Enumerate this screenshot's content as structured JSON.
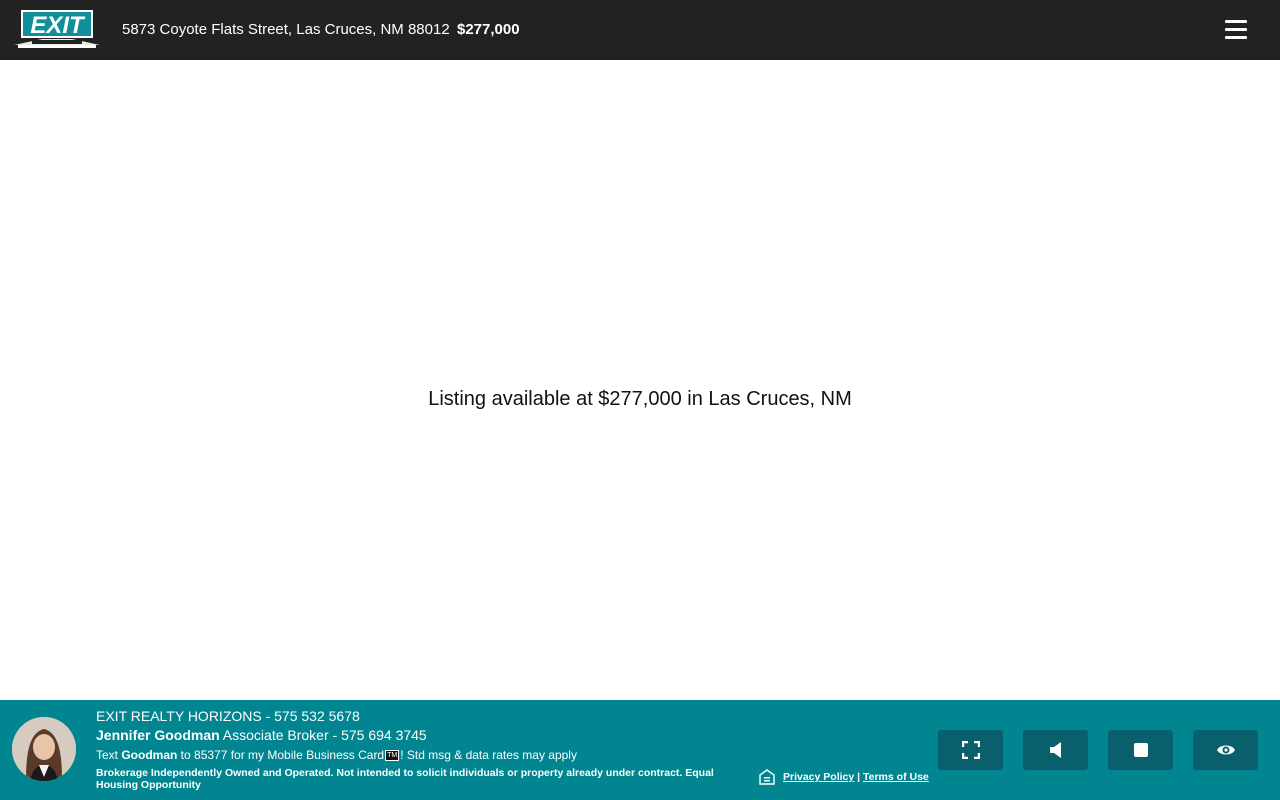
{
  "header": {
    "logo_text": "EXIT",
    "address": "5873 Coyote Flats Street, Las Cruces, NM 88012",
    "price": "$277,000",
    "menu_icon": "hamburger-menu-icon"
  },
  "main": {
    "message": "Listing available at $277,000 in Las Cruces, NM"
  },
  "footer": {
    "brokerage": "EXIT REALTY HORIZONS - 575 532 5678",
    "agent_name": "Jennifer Goodman",
    "agent_title": " Associate Broker - 575 694 3745",
    "sms_prefix": "Text ",
    "sms_keyword": "Goodman",
    "sms_middle": " to 85377 for my Mobile Business Card",
    "sms_tm": "TM",
    "sms_suffix": "! Std msg & data rates may apply",
    "disclaimer": "Brokerage Independently Owned and Operated. Not intended to solicit individuals or property already under contract. Equal Housing Opportunity",
    "privacy_label": "Privacy Policy",
    "link_separator": " | ",
    "terms_label": "Terms of Use",
    "controls": [
      {
        "name": "fullscreen-button",
        "icon": "fullscreen-icon"
      },
      {
        "name": "audio-button",
        "icon": "speaker-icon"
      },
      {
        "name": "stop-button",
        "icon": "stop-icon"
      },
      {
        "name": "view-button",
        "icon": "eye-icon"
      }
    ],
    "colors": {
      "footer_bg": "#008591",
      "button_bg": "#0a5f6c",
      "header_bg": "#222222"
    }
  }
}
